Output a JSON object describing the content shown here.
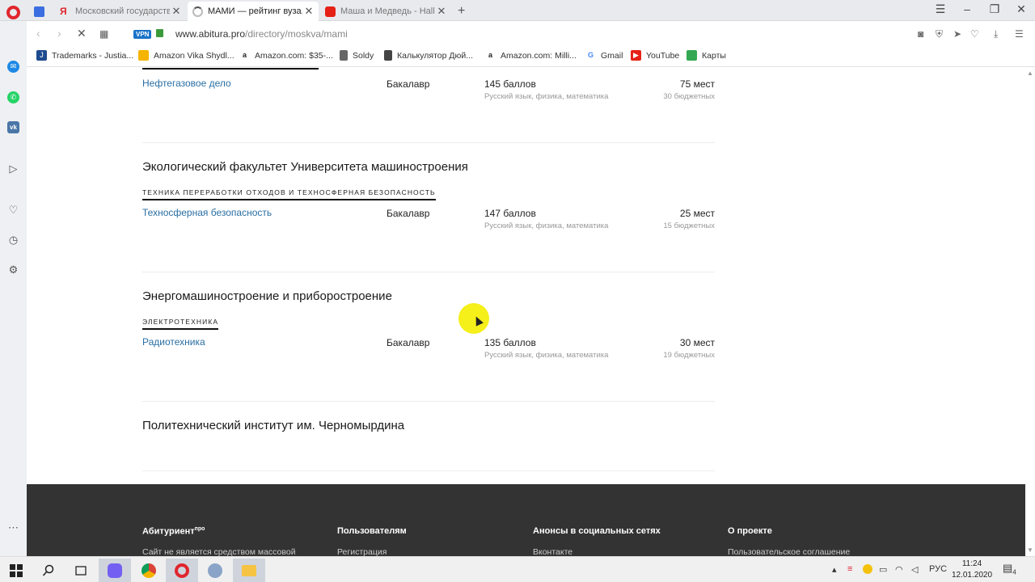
{
  "browser": {
    "tabs": [
      {
        "label": "",
        "icon": "mail-icon"
      },
      {
        "label": "Московский государстве",
        "icon": "yandex-icon"
      },
      {
        "label": "МАМИ — рейтинг вуза, о",
        "icon": "loading-icon"
      },
      {
        "label": "Маша и Медведь - Hallow",
        "icon": "youtube-icon"
      }
    ],
    "new_tab": "+",
    "close_glyph": "✕",
    "url_host": "www.abitura.pro",
    "url_path": "/directory/moskva/mami",
    "vpn_label": "VPN",
    "bookmarks": [
      {
        "label": "Trademarks - Justia...",
        "icon": "justia-icon",
        "color": "#1e4b8f"
      },
      {
        "label": "Amazon Vika Shydl...",
        "icon": "drive-icon",
        "color": "#f4b400"
      },
      {
        "label": "Amazon.com: $35-...",
        "icon": "amazon-icon",
        "color": "#222222"
      },
      {
        "label": "Soldy",
        "icon": "document-icon",
        "color": "#555555"
      },
      {
        "label": "Калькулятор Дюй...",
        "icon": "calculator-icon",
        "color": "#444444"
      },
      {
        "label": "Amazon.com: Milli...",
        "icon": "amazon-icon",
        "color": "#222222"
      },
      {
        "label": "Gmail",
        "icon": "google-icon",
        "color": "#4285f4"
      },
      {
        "label": "YouTube",
        "icon": "youtube-icon",
        "color": "#e62117"
      },
      {
        "label": "Карты",
        "icon": "maps-icon",
        "color": "#34a853"
      }
    ]
  },
  "listing": {
    "top_row": {
      "program": "Нефтегазовое дело",
      "degree": "Бакалавр",
      "score": "145 баллов",
      "subjects": "Русский язык, физика, математика",
      "places": "75 мест",
      "budget": "30 бюджетных"
    },
    "faculties": [
      {
        "name": "Экологический факультет Университета машиностроения",
        "dept": "ТЕХНИКА ПЕРЕРАБОТКИ ОТХОДОВ И ТЕХНОСФЕРНАЯ БЕЗОПАСНОСТЬ",
        "program": "Техносферная безопасность",
        "degree": "Бакалавр",
        "score": "147 баллов",
        "subjects": "Русский язык, физика, математика",
        "places": "25 мест",
        "budget": "15 бюджетных"
      },
      {
        "name": "Энергомашиностроение и приборостроение",
        "dept": "ЭЛЕКТРОТЕХНИКА",
        "program": "Радиотехника",
        "degree": "Бакалавр",
        "score": "135 баллов",
        "subjects": "Русский язык, физика, математика",
        "places": "30 мест",
        "budget": "19 бюджетных"
      },
      {
        "name": "Политехнический институт им. Черномырдина"
      }
    ]
  },
  "footer": {
    "columns": [
      {
        "heading": "Абитуриент",
        "heading_sup": "про",
        "link": "Сайт не является средством массовой"
      },
      {
        "heading": "Пользователям",
        "link": "Регистрация"
      },
      {
        "heading": "Анонсы в социальных сетях",
        "link": "Вконтакте"
      },
      {
        "heading": "О проекте",
        "link": "Пользовательское соглашение"
      }
    ]
  },
  "taskbar": {
    "language": "РУС",
    "time": "11:24",
    "date": "12.01.2020",
    "notification_count": "4"
  },
  "colors": {
    "link": "#2a6fa3",
    "footer_bg": "#333333",
    "opera_red": "#e0262e",
    "cursor_highlight": "#f5ef1a"
  }
}
